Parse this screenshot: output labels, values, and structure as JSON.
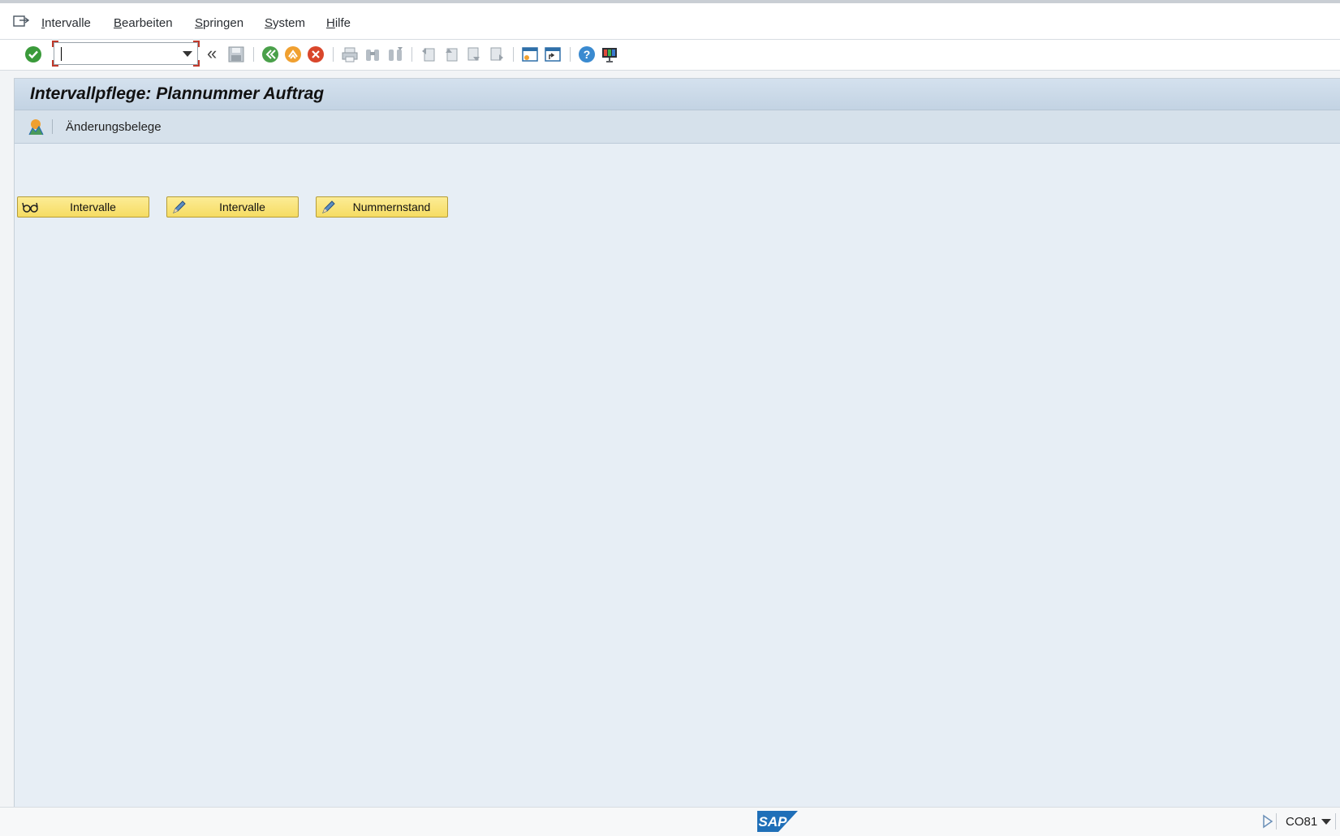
{
  "menu": {
    "items": [
      {
        "label": "Intervalle"
      },
      {
        "label": "Bearbeiten"
      },
      {
        "label": "Springen"
      },
      {
        "label": "System"
      },
      {
        "label": "Hilfe"
      }
    ]
  },
  "toolbar": {
    "command_field": {
      "value": "",
      "placeholder": ""
    },
    "icons": [
      "enter-icon",
      "command-field",
      "collapse-chevron-icon",
      "save-icon",
      "back-icon",
      "exit-icon",
      "cancel-icon",
      "print-icon",
      "find-icon",
      "find-next-icon",
      "first-page-icon",
      "previous-page-icon",
      "next-page-icon",
      "last-page-icon",
      "create-session-icon",
      "create-shortcut-icon",
      "help-icon",
      "customize-layout-icon"
    ]
  },
  "screen": {
    "title": "Intervallpflege: Plannummer Auftrag",
    "app_toolbar": {
      "change_docs_label": "Änderungsbelege"
    },
    "buttons": [
      {
        "label": "Intervalle",
        "icon": "display-glasses-icon"
      },
      {
        "label": "Intervalle",
        "icon": "pencil-icon"
      },
      {
        "label": "Nummernstand",
        "icon": "pencil-icon"
      }
    ]
  },
  "status": {
    "logo": "SAP",
    "transaction": "CO81"
  },
  "colors": {
    "accent": "#f6dc63",
    "title_bar": "#c3d3e3",
    "background": "#e7eef5",
    "sap_blue": "#1f6fb8"
  }
}
